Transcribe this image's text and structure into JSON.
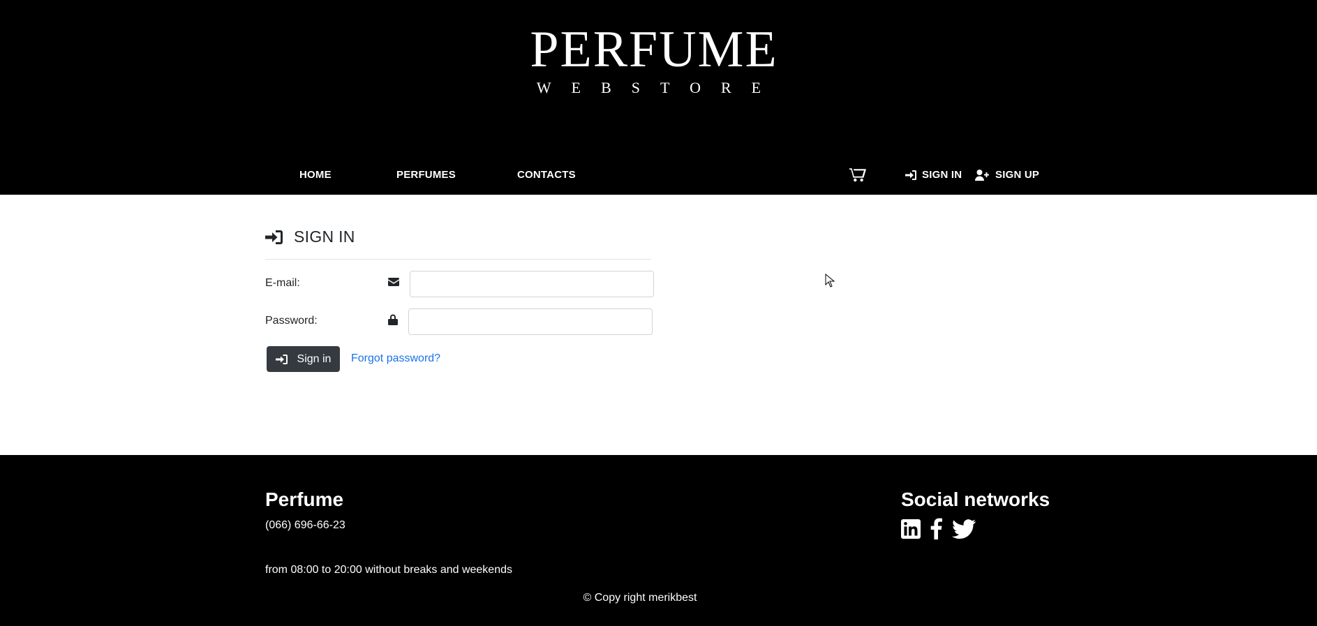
{
  "logo": {
    "title": "PERFUME",
    "subtitle": "WEBSTORE"
  },
  "nav": {
    "home": "HOME",
    "perfumes": "PERFUMES",
    "contacts": "CONTACTS",
    "sign_in": "SIGN IN",
    "sign_up": "SIGN UP",
    "cart_icon": "shopping-cart-icon"
  },
  "form": {
    "heading": "SIGN IN",
    "email_label": "E-mail:",
    "email_value": "",
    "password_label": "Password:",
    "password_value": "",
    "submit_label": "Sign in",
    "forgot_label": "Forgot password?"
  },
  "footer": {
    "brand": "Perfume",
    "phone": "(066) 696-66-23",
    "hours": "from 08:00 to 20:00 without breaks and weekends",
    "social_title": "Social networks",
    "social_icons": [
      "linkedin-icon",
      "facebook-icon",
      "twitter-icon"
    ],
    "copyright": "© Copy right merikbest"
  },
  "colors": {
    "header_bg": "#000000",
    "footer_bg": "#000000",
    "button_bg": "#343a40",
    "link": "#1a73e8"
  }
}
